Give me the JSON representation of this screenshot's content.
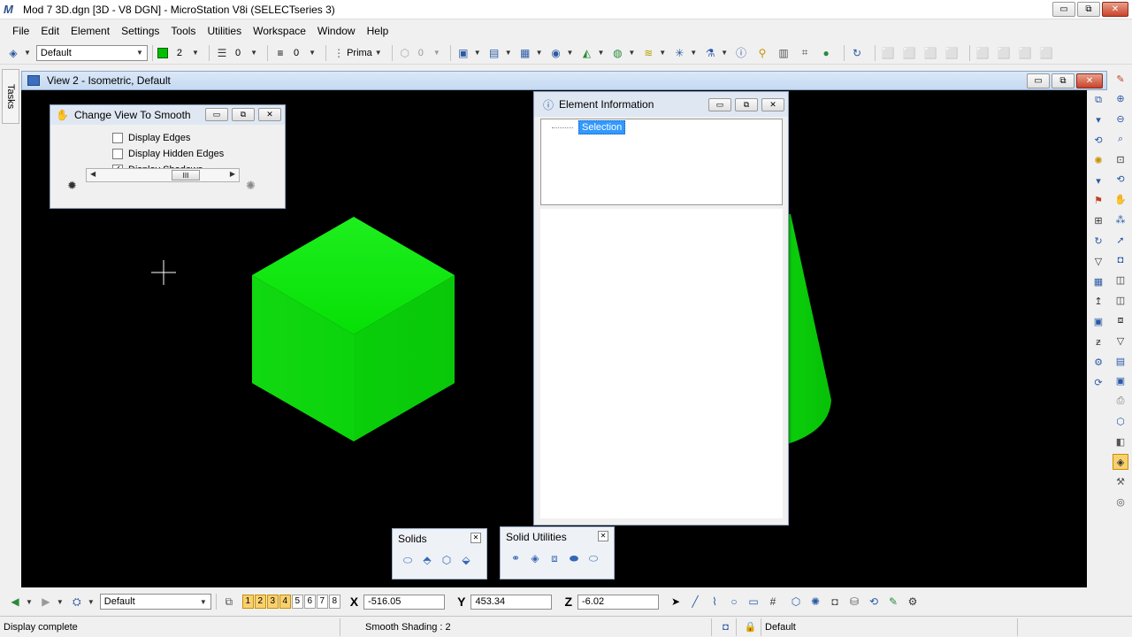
{
  "window": {
    "title": "Mod 7 3D.dgn [3D - V8 DGN] - MicroStation V8i (SELECTseries 3)",
    "app_icon": "M",
    "minimize": "▭",
    "restore": "⧉",
    "close": "✕"
  },
  "menu": [
    "File",
    "Edit",
    "Element",
    "Settings",
    "Tools",
    "Utilities",
    "Workspace",
    "Window",
    "Help"
  ],
  "attributes_toolbar": {
    "level": "Default",
    "color_index": "2",
    "line_style": "0",
    "weight": "0",
    "class": "Prima",
    "transparency": "0"
  },
  "tasks_tab": "Tasks",
  "view": {
    "title": "View 2 - Isometric, Default",
    "solids_color": "#00dd00"
  },
  "change_view_dialog": {
    "title": "Change View To Smooth",
    "options": [
      {
        "label": "Display Edges",
        "checked": false
      },
      {
        "label": "Display Hidden Edges",
        "checked": false
      },
      {
        "label": "Display Shadows",
        "checked": true
      }
    ],
    "slider_thumb": "III"
  },
  "element_info_dialog": {
    "title": "Element Information",
    "tree_item": "Selection"
  },
  "solids_toolbox": {
    "title": "Solids"
  },
  "solid_utilities_toolbox": {
    "title": "Solid Utilities"
  },
  "bottom_toolbar": {
    "level": "Default",
    "view_numbers": [
      "1",
      "2",
      "3",
      "4",
      "5",
      "6",
      "7",
      "8"
    ],
    "active_views": [
      "1",
      "2",
      "3",
      "4"
    ],
    "x_label": "X",
    "x_value": "-516.05",
    "y_label": "Y",
    "y_value": "453.34",
    "z_label": "Z",
    "z_value": "-6.02"
  },
  "status": {
    "message": "Display complete",
    "mode": "Smooth Shading : 2",
    "level": "Default"
  }
}
